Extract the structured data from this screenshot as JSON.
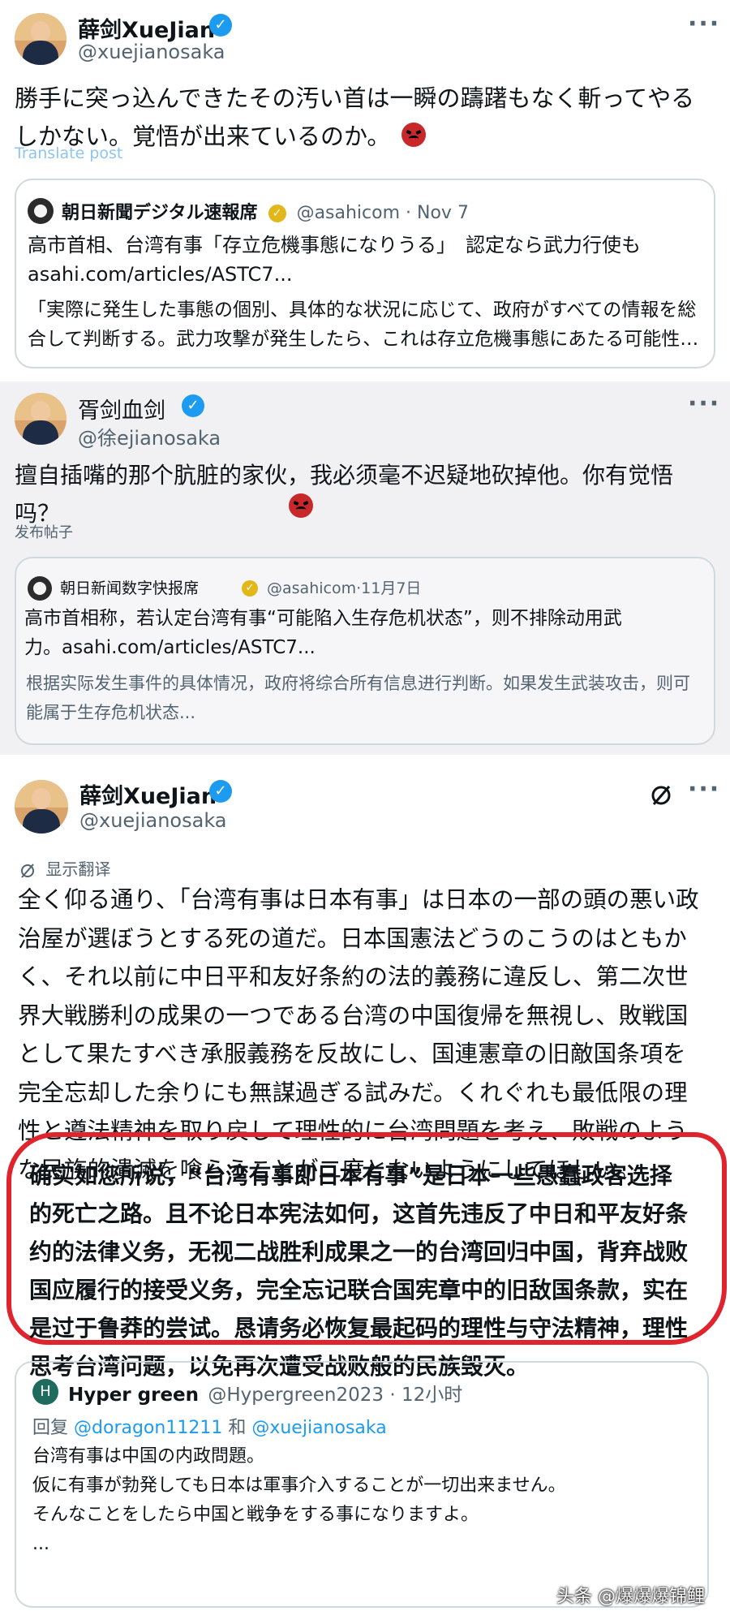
{
  "post1": {
    "name": "薛剑XueJian",
    "handle": "@xuejianosaka",
    "text": "勝手に突っ込んできたその汚い首は一瞬の躊躇もなく斬ってやるしかない。覚悟が出来ているのか。",
    "translate": "Translate post",
    "quote": {
      "name": "朝日新聞デジタル速報席",
      "meta": "@asahicom · Nov 7",
      "line1": "高市首相、台湾有事「存立危機事態になりうる」　認定なら武力行使も",
      "line2": "asahi.com/articles/ASTC7...",
      "excerpt": "「実際に発生した事態の個別、具体的な状況に応じて、政府がすべての情報を総合して判断する。武力攻撃が発生したら、これは存立危機事態にあたる可能性…"
    }
  },
  "post2": {
    "name": "胥剑血剑",
    "handle": "@徐ejianosaka",
    "text": "擅自插嘴的那个肮脏的家伙，我必须毫不迟疑地砍掉他。你有觉悟吗？",
    "translate": "发布帖子",
    "quote": {
      "name": "朝日新闻数字快报席",
      "meta": "@asahicom·11月7日",
      "line1": "高市首相称，若认定台湾有事“可能陷入生存危机状态”，则不排除动用武",
      "line2": "力。asahi.com/articles/ASTC7...",
      "excerpt": "根据实际发生事件的具体情况，政府将综合所有信息进行判断。如果发生武装攻击，则可能属于生存危机状态..."
    }
  },
  "post3": {
    "name": "薛剑XueJian",
    "handle": "@xuejianosaka",
    "translate": "显示翻译",
    "text": "全く仰る通り、「台湾有事は日本有事」は日本の一部の頭の悪い政治屋が選ぼうとする死の道だ。日本国憲法どうのこうのはともかく、それ以前に中日平和友好条約の法的義務に違反し、第二次世界大戦勝利の成果の一つである台湾の中国復帰を無視し、敗戦国として果たすべき承服義務を反故にし、国連憲章の旧敵国条項を完全忘却した余りにも無謀過ぎる試みだ。くれぐれも最低限の理性と遵法精神を取り戻して理性的に台湾問題を考え、敗戦のような民族的潰滅を喰らうことが二度とないようにしてほしい。",
    "translation": "确实如您所说，“台湾有事即日本有事”是日本一些愚蠢政客选择的死亡之路。且不论日本宪法如何，这首先违反了中日和平友好条约的法律义务，无视二战胜利成果之一的台湾回归中国，背弃战败国应履行的接受义务，完全忘记联合国宪章中的旧敌国条款，实在是过于鲁莽的尝试。恳请务必恢复最起码的理性与守法精神，理性思考台湾问题，以免再次遭受战败般的民族毁灭。",
    "reply_card": {
      "avatar_letter": "H",
      "name": "Hyper green",
      "meta": "@Hypergreen2023 · 12小时",
      "reply_prefix": "回复",
      "reply_user1": "@doragon11211",
      "reply_and": "和",
      "reply_user2": "@xuejianosaka",
      "line1": "台湾有事は中国の内政問題。",
      "line2": "仮に有事が勃発しても日本は軍事介入することが一切出来ません。",
      "line3": "そんなことをしたら中国と戦争をする事になりますよ。",
      "line4": "..."
    }
  },
  "watermark": "头条 @爆爆爆锦鲤",
  "more_label": "···",
  "colors": {
    "link": "#1d9bf0",
    "verified": "#1d9bf0",
    "gold": "#e2b719",
    "highlight": "#e0242e",
    "muted": "#536471"
  }
}
